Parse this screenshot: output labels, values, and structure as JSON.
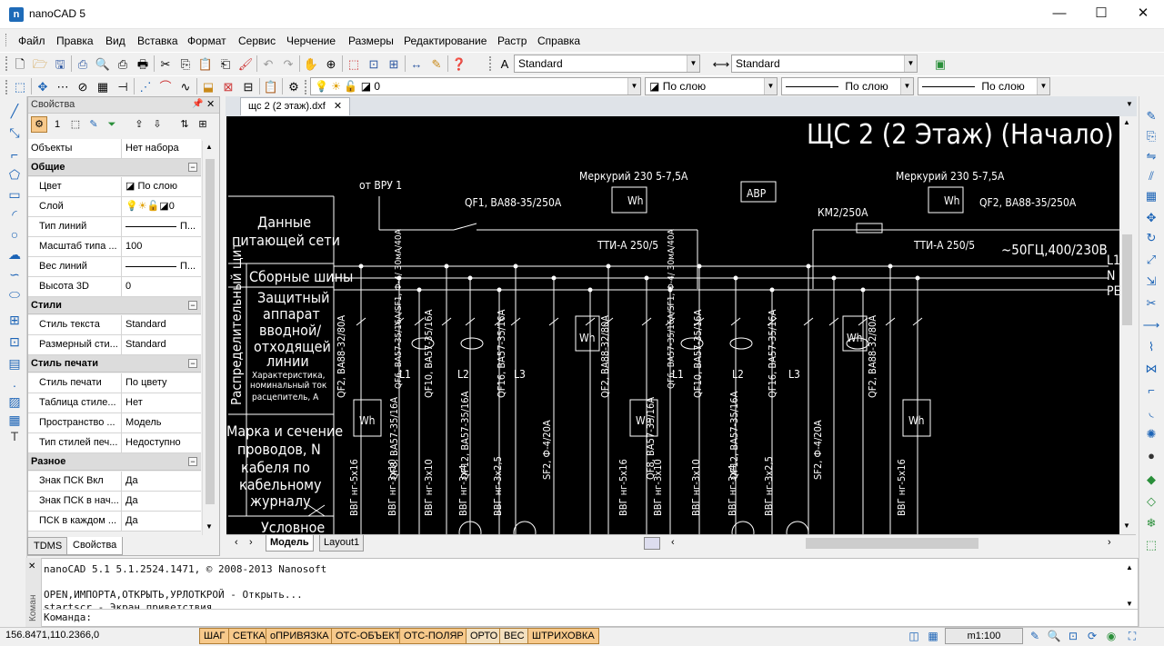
{
  "window": {
    "title": "nanoCAD 5",
    "minimize": "—",
    "maximize": "☐",
    "close": "✕"
  },
  "menu": [
    "Файл",
    "Правка",
    "Вид",
    "Вставка",
    "Формат",
    "Сервис",
    "Черчение",
    "Размеры",
    "Редактирование",
    "Растр",
    "Справка"
  ],
  "toolbar1": {
    "text_style": "Standard",
    "dim_style": "Standard"
  },
  "toolbar2": {
    "layer": "0",
    "color": "По слою",
    "linetype": "По слою",
    "lineweight": "По слою"
  },
  "properties": {
    "title": "Свойства",
    "selector_label": "Объекты",
    "selector_value": "Нет набора",
    "groups": [
      {
        "name": "Общие",
        "rows": [
          {
            "k": "Цвет",
            "v": "По слою"
          },
          {
            "k": "Слой",
            "v": "0"
          },
          {
            "k": "Тип линий",
            "v": "П..."
          },
          {
            "k": "Масштаб типа ...",
            "v": "100"
          },
          {
            "k": "Вес линий",
            "v": "П..."
          },
          {
            "k": "Высота 3D",
            "v": "0"
          }
        ]
      },
      {
        "name": "Стили",
        "rows": [
          {
            "k": "Стиль текста",
            "v": "Standard"
          },
          {
            "k": "Размерный сти...",
            "v": "Standard"
          }
        ]
      },
      {
        "name": "Стиль печати",
        "rows": [
          {
            "k": "Стиль печати",
            "v": "По цвету"
          },
          {
            "k": "Таблица стиле...",
            "v": "Нет"
          },
          {
            "k": "Пространство ...",
            "v": "Модель"
          },
          {
            "k": "Тип стилей печ...",
            "v": "Недоступно"
          }
        ]
      },
      {
        "name": "Разное",
        "rows": [
          {
            "k": "Знак ПСК Вкл",
            "v": "Да"
          },
          {
            "k": "Знак ПСК в нач...",
            "v": "Да"
          },
          {
            "k": "ПСК в каждом ...",
            "v": "Да"
          }
        ]
      }
    ],
    "tabs": [
      "TDMS",
      "Свойства"
    ]
  },
  "document": {
    "tab": "щс 2 (2 этаж).dxf",
    "layout_tabs": [
      "Модель",
      "Layout1"
    ]
  },
  "drawing": {
    "title": "ЩС 2 (2 Этаж) (Начало)",
    "from": "от ВРУ 1",
    "meter": "Меркурий 230 5-7,5А",
    "avr": "АВР",
    "km": "КМ2/250А",
    "qf1": "QF1, ВА88-35/250А",
    "qf2": "QF2, ВА88-35/250А",
    "tt": "ТТИ-А 250/5",
    "wh": "Wh",
    "supply": "~50ГЦ,400/230В",
    "phases": [
      "L1",
      "N",
      "PE"
    ],
    "legend": {
      "supply_data": [
        "Данные",
        "питающей сети"
      ],
      "buses": "Сборные шины",
      "protect": [
        "Защитный",
        "аппарат",
        "вводной/",
        "отходящей",
        "линии"
      ],
      "protect_note": [
        "Характеристика,",
        "номинальный ток",
        "расцепитель, А"
      ],
      "cables": [
        "Марка и сечение",
        "проводов, N",
        "кабеля по",
        "кабельному",
        "журналу"
      ],
      "symbol": "Условное",
      "vertical": "Распределительный щит"
    },
    "branches": [
      "QF2, ВА88-32/80А",
      "QF8, ВА57-35/16А",
      "QF10, ВА57-35/16А",
      "QF12, ВА57-35/16А",
      "QF16, ВА57-35/16А",
      "SF2, Ф-4/20А",
      "QF2, ВА88-32/80А",
      "QF8, ВА57-35/16А",
      "QF10, ВА57-35/16А",
      "QF12, ВА57-35/16А",
      "QF16, ВА57-35/16А",
      "SF2, Ф-4/20А",
      "QF2, ВА88-32/80А"
    ],
    "cables": [
      "ВВГ нг-5х16",
      "ВВГ нг-3х10",
      "ВВГ нг-3х10",
      "ВВГ нг-3х4",
      "ВВГ нг-3х2,5",
      "ВВГ нг-5х16",
      "ВВГ нг-3х10",
      "ВВГ нг-3х10",
      "ВВГ нг-3х4",
      "ВВГ нг-3х2,5",
      "ВВГ нг-5х16"
    ],
    "rcd": "QF6, ВА57-35/16А/SF1, Ф-4/ 30мА/40А",
    "meter_side": "Меркурий",
    "phase_labels": [
      "L1",
      "L2",
      "L3"
    ]
  },
  "command": {
    "lines": [
      "nanoCAD 5.1 5.1.2524.1471, © 2008-2013 Nanosoft",
      "",
      "OPEN,ИМПОРТА,ОТКРЫТЬ,УРЛОТКРОЙ - Открыть...",
      "startscr - Экран приветствия"
    ],
    "prompt": "Команда:",
    "side_label": "Коман"
  },
  "status": {
    "coords": "156.8471,110.2366,0",
    "buttons": [
      "ШАГ",
      "СЕТКА",
      "оПРИВЯЗКА",
      "ОТС-ОБЪЕКТ",
      "ОТС-ПОЛЯР",
      "ОРТО",
      "ВЕС",
      "ШТРИХОВКА"
    ],
    "scale": "m1:100"
  },
  "colors": {
    "accent": "#1b63b6",
    "canvas": "#000000",
    "status_btn": "#f7c98b"
  }
}
